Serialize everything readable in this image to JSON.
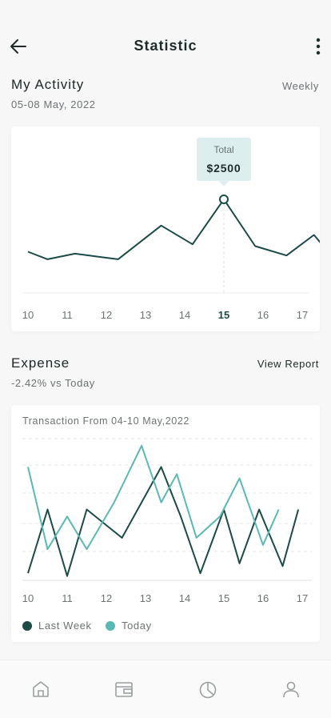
{
  "header": {
    "title": "Statistic"
  },
  "activity": {
    "title": "My Activity",
    "date": "05-08 May, 2022",
    "period": "Weekly",
    "tooltip_label": "Total",
    "tooltip_value": "$2500"
  },
  "expense": {
    "title": "Expense",
    "subtitle": "-2.42% vs Today",
    "link": "View Report",
    "card_title": "Transaction From 04-10 May,2022"
  },
  "colors": {
    "dark": "#1b4a47",
    "teal": "#5ab8b5",
    "grid": "#e8e8e8"
  },
  "chart_data": [
    {
      "type": "line",
      "categories": [
        "10",
        "11",
        "12",
        "13",
        "14",
        "15",
        "16",
        "17"
      ],
      "series": [
        {
          "values": [
            1100,
            900,
            1050,
            900,
            1800,
            1300,
            2500,
            1250,
            1000,
            1550,
            800
          ]
        }
      ],
      "point_x": [
        10,
        10.5,
        11.2,
        12.3,
        13.4,
        14.2,
        15,
        15.8,
        16.6,
        17.3,
        17.9
      ],
      "highlight": {
        "category": "15",
        "label": "Total",
        "value": "$2500"
      },
      "active_category": "15"
    },
    {
      "type": "line",
      "title": "Transaction From 04-10 May,2022",
      "categories": [
        "10",
        "11",
        "12",
        "13",
        "14",
        "15",
        "16",
        "17"
      ],
      "series": [
        {
          "name": "Last Week",
          "color": "#1b4a47",
          "x": [
            10,
            10.5,
            11,
            11.5,
            12.4,
            13.4,
            13.9,
            14.4,
            15,
            15.4,
            15.9,
            16.5,
            16.9
          ],
          "values": [
            5,
            50,
            3,
            50,
            30,
            80,
            45,
            5,
            50,
            12,
            50,
            10,
            50
          ]
        },
        {
          "name": "Today",
          "color": "#5ab8b5",
          "x": [
            10,
            10.5,
            11,
            11.5,
            12.2,
            12.9,
            13.4,
            13.8,
            14.3,
            14.9,
            15.4,
            16,
            16.4
          ],
          "values": [
            80,
            22,
            45,
            22,
            55,
            95,
            55,
            75,
            30,
            45,
            72,
            25,
            50
          ]
        }
      ]
    }
  ],
  "legend": {
    "last_week": "Last Week",
    "today": "Today"
  },
  "nav": [
    "home-icon",
    "wallet-icon",
    "pie-chart-icon",
    "profile-icon"
  ]
}
